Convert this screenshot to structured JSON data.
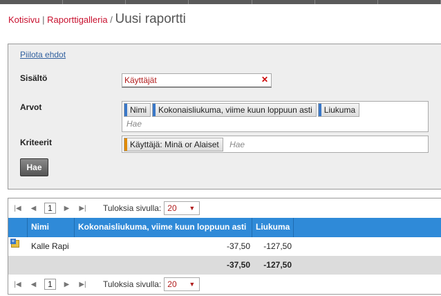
{
  "breadcrumb": {
    "home": "Kotisivu",
    "sep1": "|",
    "gallery": "Raporttigalleria",
    "sep2": "/",
    "current": "Uusi raportti"
  },
  "filters": {
    "hide_link": "Piilota ehdot",
    "content_label": "Sisältö",
    "content_value": "Käyttäjät",
    "values_label": "Arvot",
    "values_tags": [
      "Nimi",
      "Kokonaisliukuma, viime kuun loppuun asti",
      "Liukuma"
    ],
    "values_placeholder": "Hae",
    "criteria_label": "Kriteerit",
    "criteria_tags": [
      "Käyttäjä: Minä or Alaiset"
    ],
    "criteria_placeholder": "Hae",
    "search_button": "Hae"
  },
  "pager": {
    "page": "1",
    "per_page_label": "Tuloksia sivulla:",
    "per_page": "20"
  },
  "table": {
    "columns": [
      "Nimi",
      "Kokonaisliukuma, viime kuun loppuun asti",
      "Liukuma"
    ],
    "rows": [
      {
        "name": "Kalle Rapi",
        "total": "-37,50",
        "change": "-127,50"
      }
    ],
    "totals": {
      "total": "-37,50",
      "change": "-127,50"
    }
  }
}
